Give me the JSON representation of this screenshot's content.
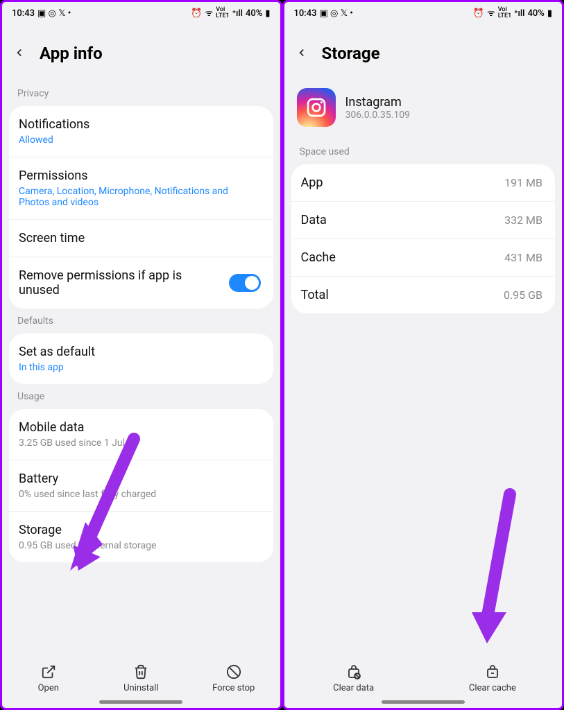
{
  "status": {
    "time": "10:43",
    "icons_left": "◷ ⊚ 𝕏 •",
    "icons_right": "⏰ ᯤ ᵛᵒᴸᵀᴱ₁ ₊ıl 40%🔋",
    "battery": "40%"
  },
  "left": {
    "title": "App info",
    "sections": {
      "privacy": "Privacy",
      "defaults": "Defaults",
      "usage": "Usage"
    },
    "rows": {
      "notifications": {
        "title": "Notifications",
        "sub": "Allowed"
      },
      "permissions": {
        "title": "Permissions",
        "sub": "Camera, Location, Microphone, Notifications and Photos and videos"
      },
      "screentime": {
        "title": "Screen time"
      },
      "removeperms": {
        "title": "Remove permissions if app is unused"
      },
      "setdefault": {
        "title": "Set as default",
        "sub": "In this app"
      },
      "mobiledata": {
        "title": "Mobile data",
        "sub": "3.25 GB used since 1 Jul"
      },
      "battery": {
        "title": "Battery",
        "sub": "0% used since last fully charged"
      },
      "storage": {
        "title": "Storage",
        "sub": "0.95 GB used in Internal storage"
      }
    },
    "actions": {
      "open": "Open",
      "uninstall": "Uninstall",
      "forcestop": "Force stop"
    }
  },
  "right": {
    "title": "Storage",
    "app": {
      "name": "Instagram",
      "version": "306.0.0.35.109"
    },
    "section": "Space used",
    "rows": {
      "app": {
        "label": "App",
        "value": "191 MB"
      },
      "data": {
        "label": "Data",
        "value": "332 MB"
      },
      "cache": {
        "label": "Cache",
        "value": "431 MB"
      },
      "total": {
        "label": "Total",
        "value": "0.95 GB"
      }
    },
    "actions": {
      "cleardata": "Clear data",
      "clearcache": "Clear cache"
    }
  }
}
